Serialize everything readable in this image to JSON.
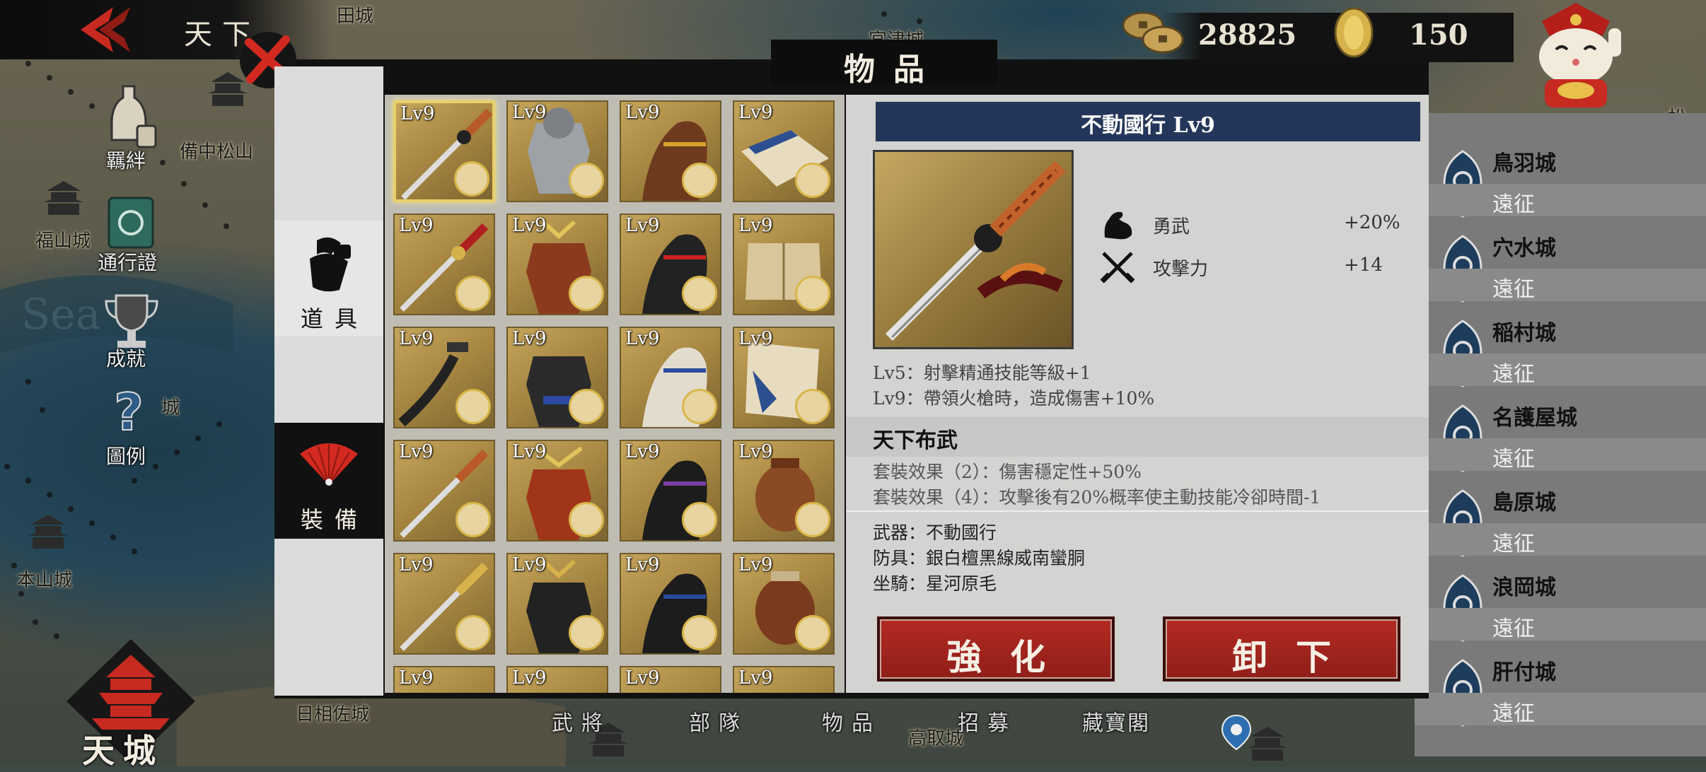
{
  "top_bar": {
    "realm_title": "天下",
    "coins": "28825",
    "gold": "150"
  },
  "map_labels": {
    "castle_top1": "田城",
    "castle_top2": "宮津城",
    "bizen": "備中松山",
    "fukuyama": "福山城",
    "honzan": "本山城",
    "nikko": "日相佐城",
    "takatori": "高取城",
    "sea": "Sea",
    "matsu": "松",
    "kisei": "城"
  },
  "side_menu": {
    "bonds": "羈絆",
    "pass": "通行證",
    "achievements": "成就",
    "help": "圖例",
    "pi_castle": "城"
  },
  "city_list": [
    {
      "name": "鳥羽城",
      "status": "遠征"
    },
    {
      "name": "穴水城",
      "status": "遠征"
    },
    {
      "name": "稲村城",
      "status": "遠征"
    },
    {
      "name": "名護屋城",
      "status": "遠征"
    },
    {
      "name": "島原城",
      "status": "遠征"
    },
    {
      "name": "浪岡城",
      "status": "遠征"
    },
    {
      "name": "肝付城",
      "status": "遠征"
    }
  ],
  "dialog": {
    "title": "物品",
    "tabs": [
      {
        "label": "道具"
      },
      {
        "label": "裝備"
      }
    ],
    "grid_level": "Lv9",
    "selected_item": {
      "name": "不動國行 Lv9",
      "stats": [
        {
          "label": "勇武",
          "value": "+20%",
          "icon": "arm-icon"
        },
        {
          "label": "攻擊力",
          "value": "+14",
          "icon": "crossed-swords-icon"
        }
      ],
      "skills": [
        "Lv5：射擊精通技能等級+1",
        "Lv9：帶領火槍時，造成傷害+10%"
      ],
      "set_name": "天下布武",
      "set_effects": [
        "套裝效果（2）：傷害穩定性+50%",
        "套裝效果（4）：攻擊後有20%概率使主動技能冷卻時間-1"
      ],
      "equipment": [
        "武器：不動國行",
        "防具：銀白檀黑線威南蠻胴",
        "坐騎：星河原毛"
      ]
    },
    "buttons": {
      "enhance": "強化",
      "unequip": "卸下"
    }
  },
  "bottom_nav": {
    "generals": "武將",
    "troops": "部隊",
    "items": "物品",
    "recruit": "招募",
    "treasury": "藏寶閣",
    "castle": "天城"
  }
}
